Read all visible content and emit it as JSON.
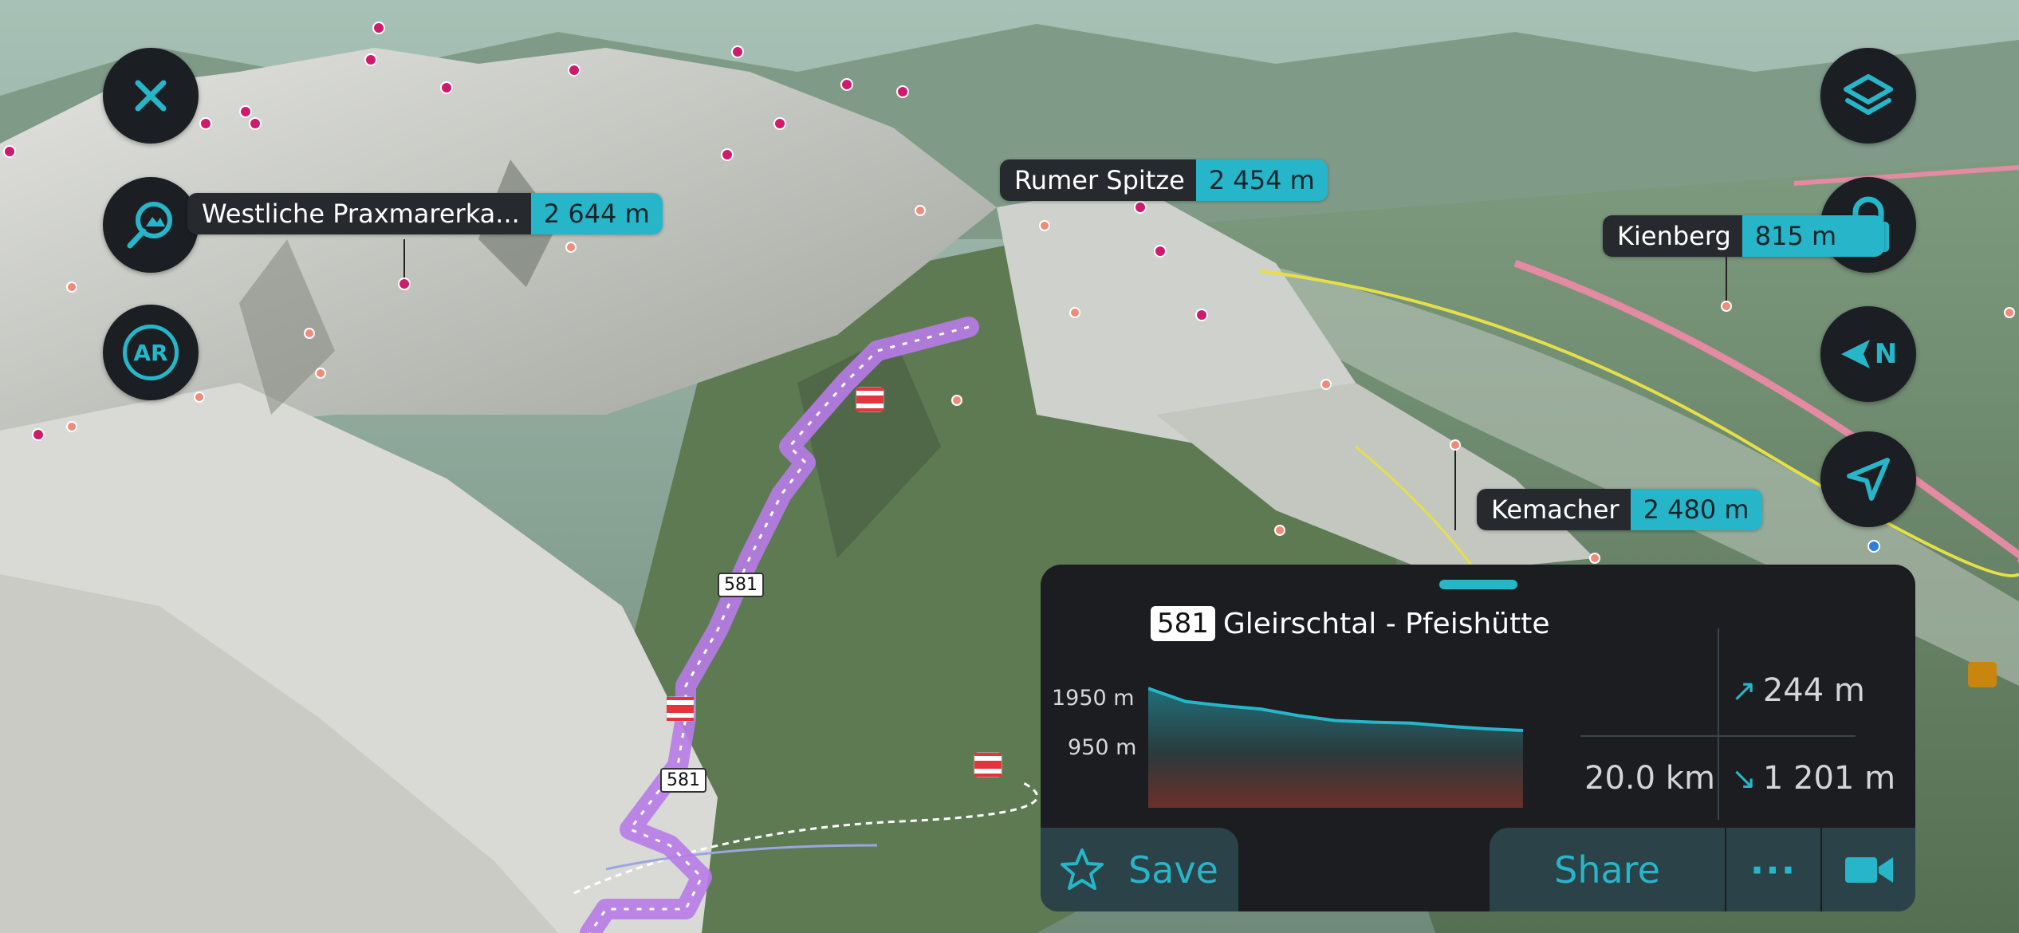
{
  "controls": {
    "close_icon": "close-icon",
    "search_icon": "map-search-icon",
    "ar_label": "AR",
    "layers_icon": "layers-icon",
    "lock_icon": "lock-icon",
    "compass_label": "N",
    "locate_icon": "location-arrow-icon"
  },
  "peaks": [
    {
      "name": "Westliche Praxmarerka...",
      "elevation": "2 644 m"
    },
    {
      "name": "Rumer Spitze",
      "elevation": "2 454 m"
    },
    {
      "name": "Kienberg",
      "elevation": "815 m"
    },
    {
      "name": "Kemacher",
      "elevation": "2 480 m"
    }
  ],
  "route_signs": [
    "581",
    "581"
  ],
  "route_panel": {
    "route_number": "581",
    "route_name": "Gleirschtal - Pfeishütte",
    "profile_max_label": "1950 m",
    "profile_min_label": "950 m",
    "ascent": "244 m",
    "descent": "1 201 m",
    "distance": "20.0 km",
    "save_label": "Save",
    "share_label": "Share",
    "more_label": "···",
    "video_icon": "video-camera-icon"
  },
  "colors": {
    "accent": "#27b6c9",
    "route": "#b77be8",
    "panel_bg": "#1b1d20",
    "peak_marker": "#d01a6e"
  },
  "chart_data": {
    "type": "area",
    "x": [
      0,
      2,
      4,
      6,
      8,
      10,
      12,
      14,
      16,
      18,
      20
    ],
    "values": [
      1950,
      1790,
      1740,
      1700,
      1620,
      1560,
      1540,
      1530,
      1490,
      1460,
      1440
    ],
    "xlabel": "",
    "ylabel": "",
    "ylim": [
      500,
      2050
    ]
  }
}
